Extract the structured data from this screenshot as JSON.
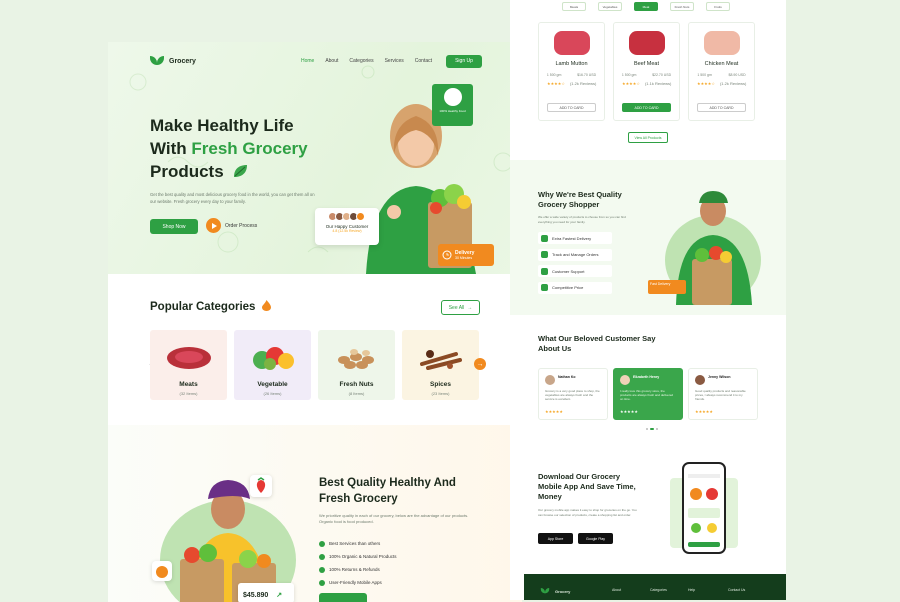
{
  "left": {
    "nav": {
      "brand": "Grocery",
      "links": [
        "Home",
        "About",
        "Categories",
        "Services",
        "Contact"
      ],
      "signup": "Sign Up"
    },
    "hero": {
      "line1": "Make Healthy Life",
      "line2_a": "With ",
      "line2_b": "Fresh Grocery",
      "line3": "Products",
      "desc": "Get the best quality and most delicious grocery food in the world, you can get them all on our website. Fresh grocery every day to your family.",
      "shop_now": "Shop Now",
      "order_process": "Order Process",
      "happy_customer": "Our Happy Customer",
      "happy_rating": "4.8 (12.5k Review)",
      "delivery": "Delivery",
      "delivery_sub": "30 Minutes",
      "top_card": "100% Healthy Food"
    },
    "categories": {
      "title": "Popular Categories",
      "see_all": "See All",
      "items": [
        {
          "name": "Meats",
          "count": "(32 Items)",
          "bg": "#fbeeea"
        },
        {
          "name": "Vegetable",
          "count": "(26 Items)",
          "bg": "#f1ecf8"
        },
        {
          "name": "Fresh Nuts",
          "count": "(8 Items)",
          "bg": "#eef6ea"
        },
        {
          "name": "Spices",
          "count": "(23 Items)",
          "bg": "#fbf4e2"
        }
      ]
    },
    "best": {
      "line1": "Best Quality Healthy And",
      "line2": "Fresh Grocery",
      "desc": "We prioritize quality in each of our grocery, below are the advantage of our products. Organic food is food produced.",
      "features": [
        "Best Services than others",
        "100% Organic & Natural Products",
        "100% Returns & Refunds",
        "User-Friendly Mobile Apps"
      ],
      "price": "$45.890"
    }
  },
  "right": {
    "filters": [
      "Meats",
      "Vegetables",
      "Meat",
      "Fresh Nuts",
      "Fruits"
    ],
    "products": [
      {
        "name": "Lamb Mutton",
        "weight": "1 500 gm",
        "price": "$16.70 USD",
        "reviews": "(1.2k Reviews)",
        "add": "ADD TO CARD",
        "color": "#d9475a"
      },
      {
        "name": "Beef Meat",
        "weight": "1 500 gm",
        "price": "$22.70 USD",
        "reviews": "(1.1k Reviews)",
        "add": "ADD TO CARD",
        "color": "#c7303f"
      },
      {
        "name": "Chicken Meat",
        "weight": "1 500 gm",
        "price": "$8.90 USD",
        "reviews": "(1.2k Reviews)",
        "add": "ADD TO CARD",
        "color": "#f0b9a6"
      }
    ],
    "view_all": "View All Products",
    "why": {
      "title": "Why We're Best Quality Grocery Shopper",
      "desc": "We offer a wide variety of products to choose from so you can find everything you need for your family.",
      "items": [
        "Extra Fastest Delivery",
        "Track and Manage Orders",
        "Customer Support",
        "Competitive Price"
      ],
      "fast": "Fast Delivery"
    },
    "testimonials": {
      "title": "What Our Beloved Customer Say About Us",
      "items": [
        {
          "name": "Nathan Ko",
          "text": "Grocery is a very good place to shop, the vegetables are always fresh and the service is excellent."
        },
        {
          "name": "Elizabeth Henry",
          "text": "I really love this grocery store, the products are always fresh and delivered on time."
        },
        {
          "name": "Jenny Wilson",
          "text": "Good quality products and reasonable prices, I always recommend it to my friends."
        }
      ]
    },
    "download": {
      "title": "Download Our Grocery Mobile App And Save Time, Money",
      "desc": "Our grocery mobile app makes it easy to shop for groceries on the go. You can browse our selection of products, create a shopping list and order.",
      "app_store": "App Store",
      "google_play": "Google Play"
    },
    "footer": {
      "brand": "Grocery",
      "cols": [
        "About",
        "Categories",
        "Help",
        "Contact Us"
      ]
    }
  }
}
